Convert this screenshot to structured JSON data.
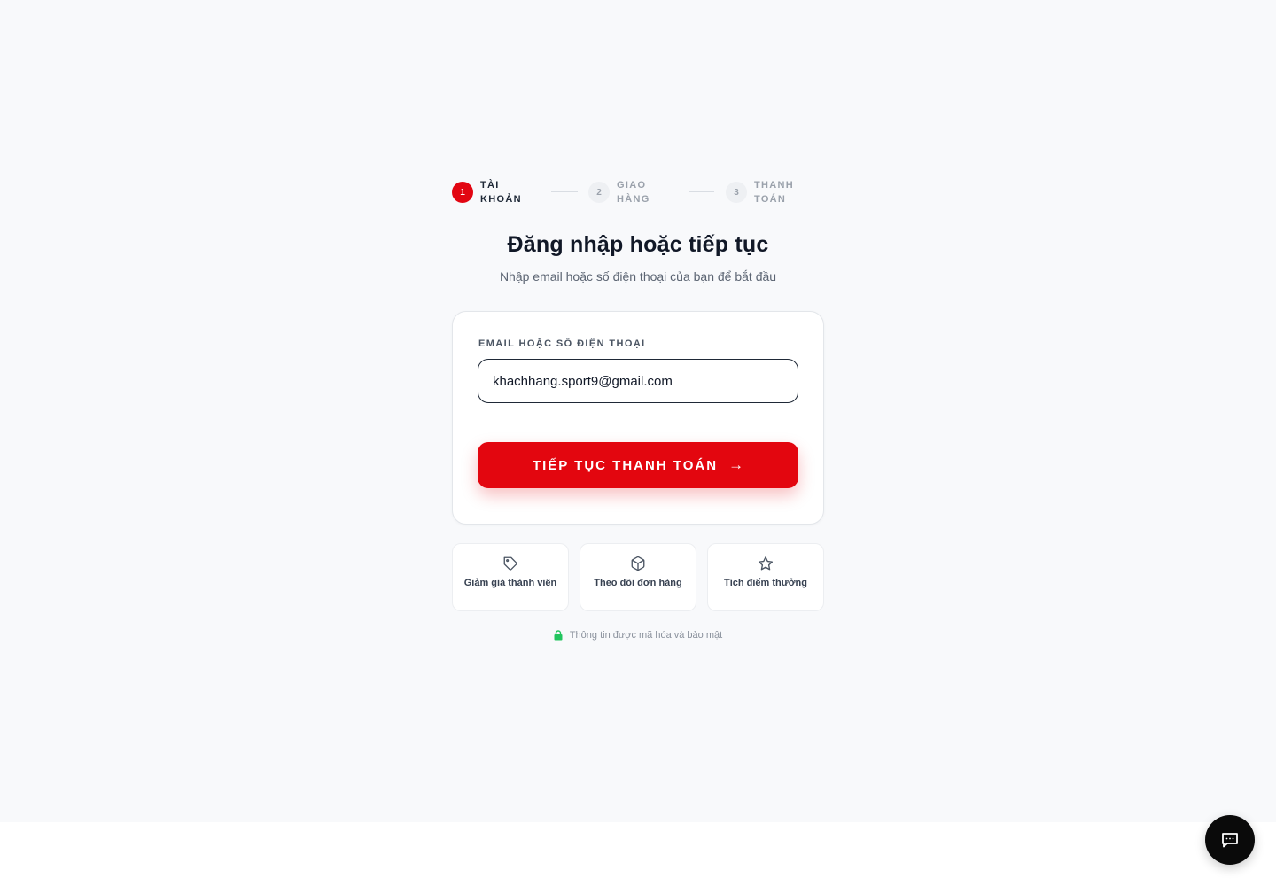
{
  "stepper": {
    "steps": [
      {
        "number": "1",
        "label_line1": "TÀI",
        "label_line2": "KHOẢN",
        "state": "active"
      },
      {
        "number": "2",
        "label_line1": "GIAO",
        "label_line2": "HÀNG",
        "state": "inactive"
      },
      {
        "number": "3",
        "label_line1": "THANH",
        "label_line2": "TOÁN",
        "state": "inactive"
      }
    ]
  },
  "heading": {
    "title": "Đăng nhập hoặc tiếp tục",
    "subtitle": "Nhập email hoặc số điện thoại của bạn để bắt đầu"
  },
  "form": {
    "label": "EMAIL HOẶC SỐ ĐIỆN THOẠI",
    "value": "khachhang.sport9@gmail.com",
    "submit_label": "TIẾP TỤC THANH TOÁN",
    "submit_arrow": "→"
  },
  "benefits": [
    {
      "icon": "tag-icon",
      "label": "Giảm giá thành viên"
    },
    {
      "icon": "box-icon",
      "label": "Theo dõi đơn hàng"
    },
    {
      "icon": "star-icon",
      "label": "Tích điểm thưởng"
    }
  ],
  "security_note": {
    "icon": "lock-icon",
    "text": "Thông tin được mã hóa và bảo mật"
  },
  "chat": {
    "icon": "chat-icon"
  },
  "colors": {
    "accent": "#e3060f",
    "background": "#f8f9fb",
    "secure_green": "#22c55e"
  }
}
